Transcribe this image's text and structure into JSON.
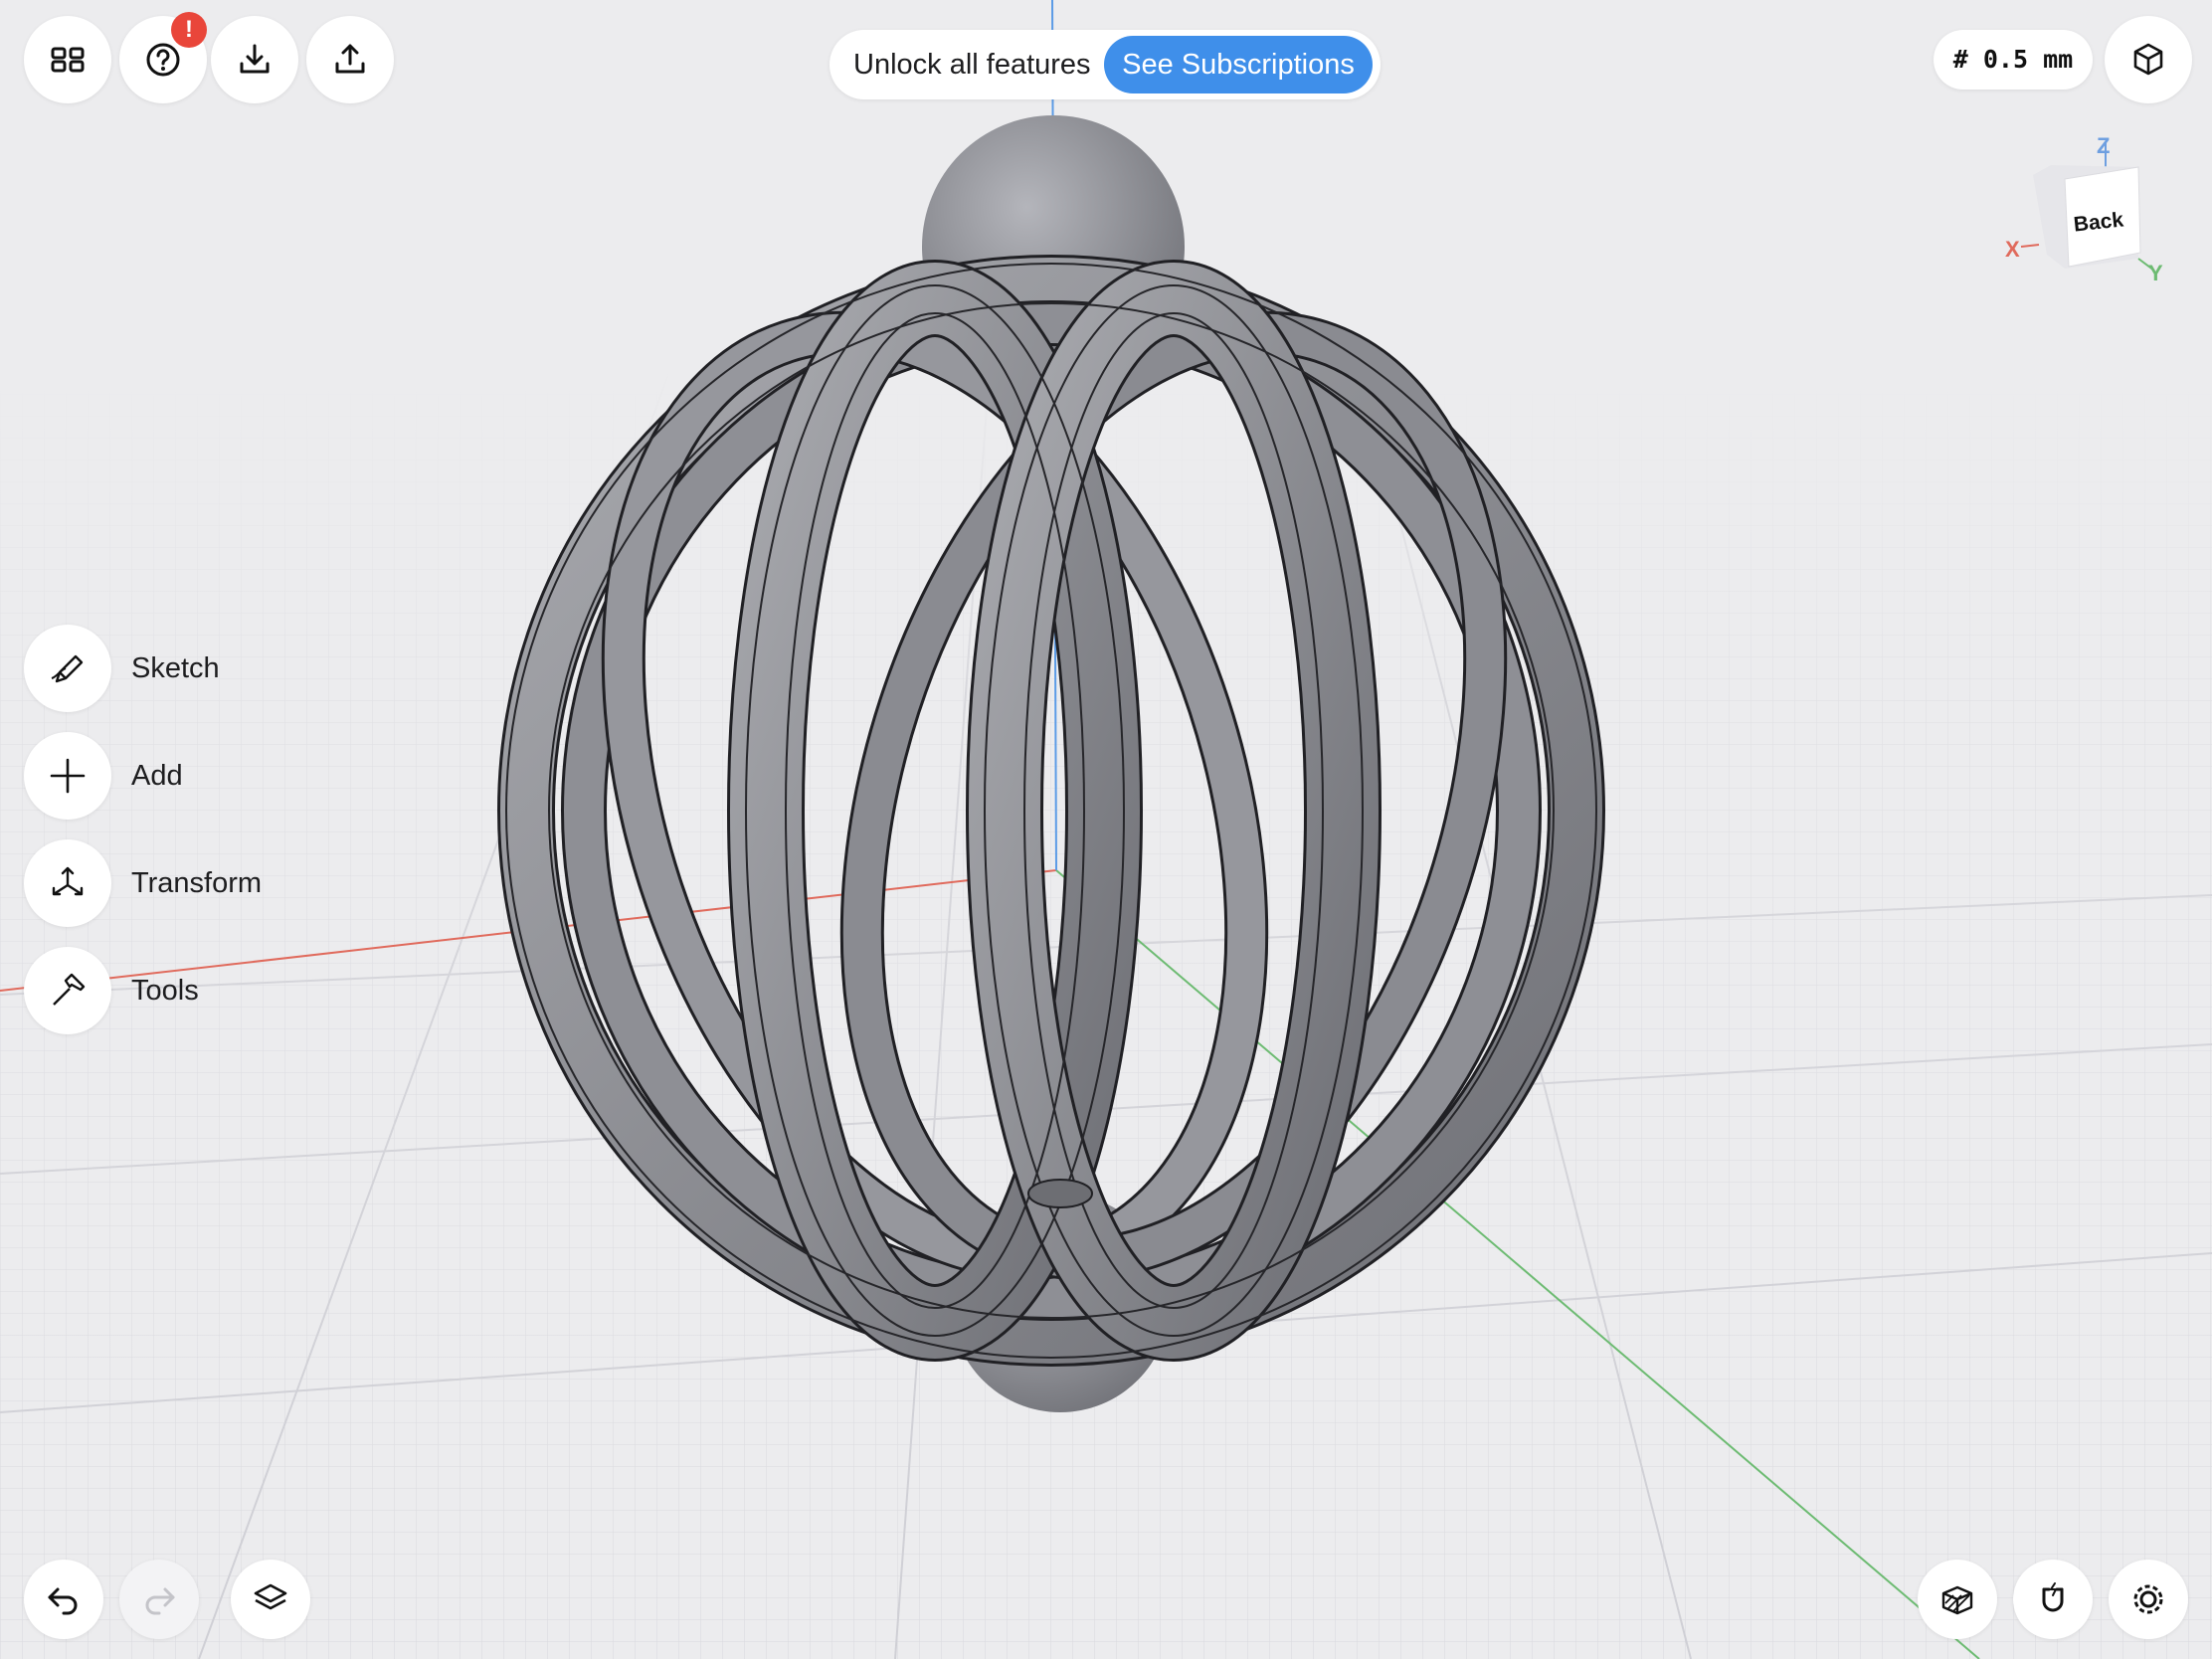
{
  "toolbar": {
    "left_icons": [
      "grid-icon",
      "help-icon",
      "import-icon",
      "export-icon"
    ],
    "help_badge": "!",
    "right_icon": "view-cube-icon"
  },
  "promo": {
    "text": "Unlock all features",
    "button_label": "See Subscriptions",
    "button_color": "#3f8fea"
  },
  "grid_size": "# 0.5 mm",
  "view_cube": {
    "face_label": "Back",
    "axes": {
      "x": "X",
      "y": "Y",
      "z": "Z"
    }
  },
  "side_menu": [
    {
      "label": "Sketch",
      "icon": "pencil-icon"
    },
    {
      "label": "Add",
      "icon": "plus-icon"
    },
    {
      "label": "Transform",
      "icon": "transform-arrows-icon"
    },
    {
      "label": "Tools",
      "icon": "hammer-icon"
    }
  ],
  "bottom_left": [
    "undo-icon",
    "redo-icon",
    "layers-icon"
  ],
  "bottom_right": [
    "render-mode-icon",
    "snap-magnet-icon",
    "settings-gear-icon"
  ],
  "colors": {
    "background": "#ececee",
    "axis_x": "#e06a5c",
    "axis_y": "#6dbb72",
    "axis_z": "#5b9be6",
    "badge": "#e9463a"
  }
}
